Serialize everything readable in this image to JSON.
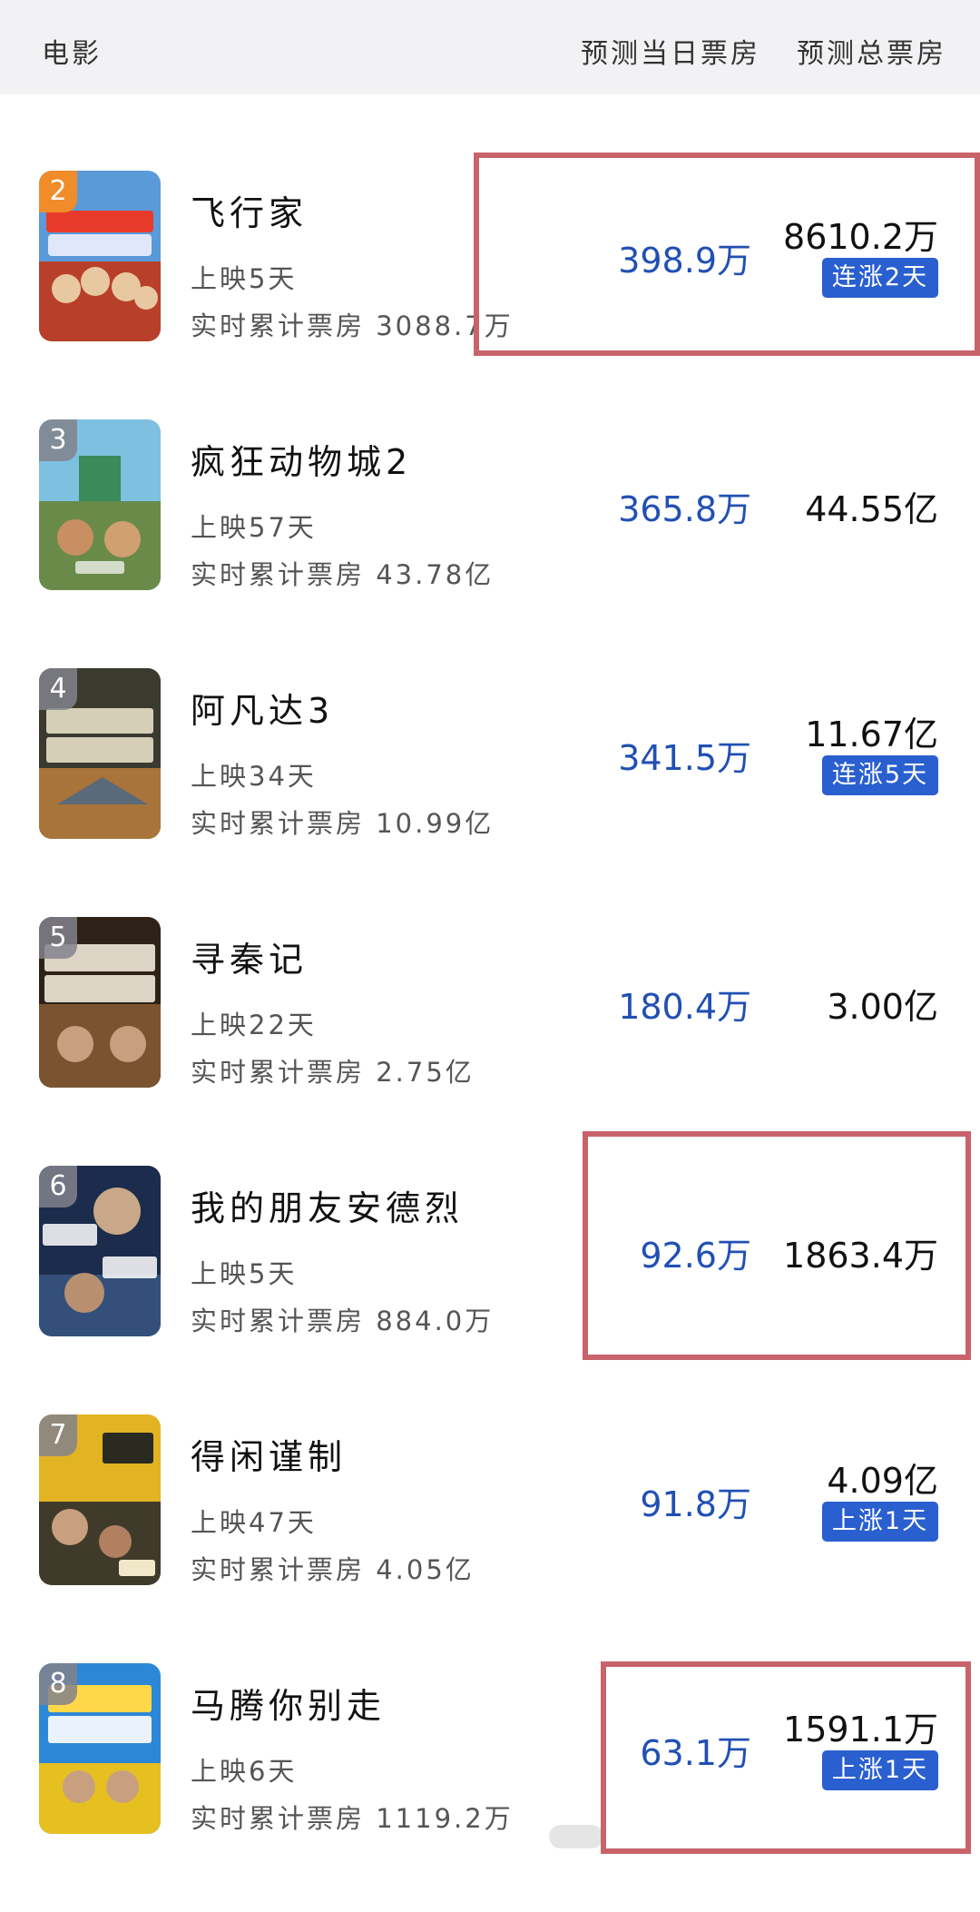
{
  "header": {
    "movie_label": "电影",
    "daily_label": "预测当日票房",
    "total_label": "预测总票房"
  },
  "movies": [
    {
      "rank": "2",
      "title": "飞行家",
      "days": "上映5天",
      "cumulative": "实时累计票房 3088.7万",
      "daily": "398.9万",
      "total": "8610.2万",
      "badge": "连涨2天",
      "poster_text": "口碑佳作 全家快乐",
      "poster_colors": [
        "#4a8ed0",
        "#c83a2a"
      ]
    },
    {
      "rank": "3",
      "title": "疯狂动物城2",
      "days": "上映57天",
      "cumulative": "实时累计票房 43.78亿",
      "daily": "365.8万",
      "total": "44.55亿",
      "badge": "",
      "poster_text": "11月26日",
      "poster_colors": [
        "#6fb6d8",
        "#5a7a3a"
      ]
    },
    {
      "rank": "4",
      "title": "阿凡达3",
      "days": "上映34天",
      "cumulative": "实时累计票房 10.99亿",
      "daily": "341.5万",
      "total": "11.67亿",
      "badge": "连涨5天",
      "poster_text": "影史传奇 重磅回归",
      "poster_colors": [
        "#3a3a2a",
        "#b07a3a"
      ]
    },
    {
      "rank": "5",
      "title": "寻秦记",
      "days": "上映22天",
      "cumulative": "实时累计票房 2.75亿",
      "daily": "180.4万",
      "total": "3.00亿",
      "badge": "",
      "poster_text": "穿越经典 全家爱看",
      "poster_colors": [
        "#3a2a1a",
        "#8a5a2a"
      ]
    },
    {
      "rank": "6",
      "title": "我的朋友安德烈",
      "days": "上映5天",
      "cumulative": "实时累计票房 884.0万",
      "daily": "92.6万",
      "total": "1863.4万",
      "badge": "",
      "poster_text": "好友相伴 冬日必看",
      "poster_colors": [
        "#1a2a4a",
        "#3a5a8a"
      ]
    },
    {
      "rank": "7",
      "title": "得闲谨制",
      "days": "上映47天",
      "cumulative": "实时累计票房 4.05亿",
      "daily": "91.8万",
      "total": "4.09亿",
      "badge": "上涨1天",
      "poster_text": "谨制 12月6日",
      "poster_colors": [
        "#e0b020",
        "#3a3a2a"
      ]
    },
    {
      "rank": "8",
      "title": "马腾你别走",
      "days": "上映6天",
      "cumulative": "实时累计票房 1119.2万",
      "daily": "63.1万",
      "total": "1591.1万",
      "badge": "上涨1天",
      "poster_text": "妈笑了 这票值了",
      "poster_colors": [
        "#2a8ad8",
        "#e8c020"
      ]
    }
  ]
}
